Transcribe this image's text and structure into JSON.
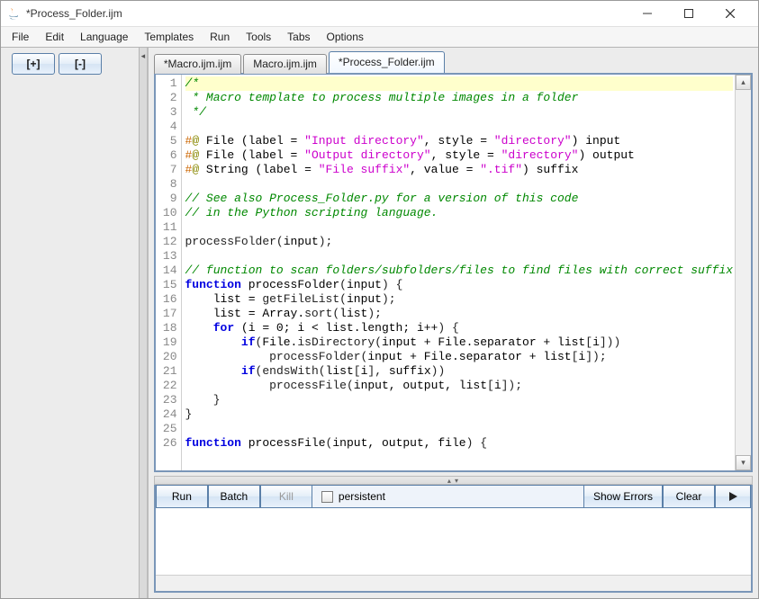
{
  "title": "*Process_Folder.ijm",
  "menu": [
    "File",
    "Edit",
    "Language",
    "Templates",
    "Run",
    "Tools",
    "Tabs",
    "Options"
  ],
  "pm": {
    "plus": "[+]",
    "minus": "[-]"
  },
  "collapse_marker": "◂",
  "tabs": [
    {
      "label": "*Macro.ijm.ijm",
      "active": false
    },
    {
      "label": "Macro.ijm.ijm",
      "active": false
    },
    {
      "label": "*Process_Folder.ijm",
      "active": true
    }
  ],
  "runbar": {
    "run": "Run",
    "batch": "Batch",
    "kill": "Kill",
    "persistent": "persistent",
    "show_errors": "Show Errors",
    "clear": "Clear"
  },
  "scroll": {
    "up": "▴",
    "down": "▾"
  },
  "code": {
    "lines": [
      {
        "n": 1,
        "hl": true,
        "tokens": [
          [
            "comment",
            "/*"
          ]
        ]
      },
      {
        "n": 2,
        "hl": false,
        "tokens": [
          [
            "comment",
            " * Macro template to process multiple images in a folder"
          ]
        ]
      },
      {
        "n": 3,
        "hl": false,
        "tokens": [
          [
            "comment",
            " */"
          ]
        ]
      },
      {
        "n": 4,
        "hl": false,
        "tokens": []
      },
      {
        "n": 5,
        "hl": false,
        "tokens": [
          [
            "hash",
            "#"
          ],
          [
            "at",
            "@"
          ],
          [
            "id",
            " File (label = "
          ],
          [
            "str",
            "\"Input directory\""
          ],
          [
            "id",
            ", style = "
          ],
          [
            "str",
            "\"directory\""
          ],
          [
            "id",
            ") input"
          ]
        ]
      },
      {
        "n": 6,
        "hl": false,
        "tokens": [
          [
            "hash",
            "#"
          ],
          [
            "at",
            "@"
          ],
          [
            "id",
            " File (label = "
          ],
          [
            "str",
            "\"Output directory\""
          ],
          [
            "id",
            ", style = "
          ],
          [
            "str",
            "\"directory\""
          ],
          [
            "id",
            ") output"
          ]
        ]
      },
      {
        "n": 7,
        "hl": false,
        "tokens": [
          [
            "hash",
            "#"
          ],
          [
            "at",
            "@"
          ],
          [
            "id",
            " String (label = "
          ],
          [
            "str",
            "\"File suffix\""
          ],
          [
            "id",
            ", value = "
          ],
          [
            "str",
            "\".tif\""
          ],
          [
            "id",
            ") suffix"
          ]
        ]
      },
      {
        "n": 8,
        "hl": false,
        "tokens": []
      },
      {
        "n": 9,
        "hl": false,
        "tokens": [
          [
            "comment",
            "// See also Process_Folder.py for a version of this code"
          ]
        ]
      },
      {
        "n": 10,
        "hl": false,
        "tokens": [
          [
            "comment",
            "// in the Python scripting language."
          ]
        ]
      },
      {
        "n": 11,
        "hl": false,
        "tokens": []
      },
      {
        "n": 12,
        "hl": false,
        "tokens": [
          [
            "call",
            "processFolder"
          ],
          [
            "pu",
            "("
          ],
          [
            "id",
            "input"
          ],
          [
            "pu",
            ");"
          ]
        ]
      },
      {
        "n": 13,
        "hl": false,
        "tokens": []
      },
      {
        "n": 14,
        "hl": false,
        "tokens": [
          [
            "comment",
            "// function to scan folders/subfolders/files to find files with correct suffix"
          ]
        ]
      },
      {
        "n": 15,
        "hl": false,
        "tokens": [
          [
            "kw",
            "function"
          ],
          [
            "id",
            " processFolder"
          ],
          [
            "pu",
            "("
          ],
          [
            "id",
            "input"
          ],
          [
            "pu",
            ") {"
          ]
        ]
      },
      {
        "n": 16,
        "hl": false,
        "tokens": [
          [
            "id",
            "    list = "
          ],
          [
            "call",
            "getFileList"
          ],
          [
            "pu",
            "("
          ],
          [
            "id",
            "input"
          ],
          [
            "pu",
            ");"
          ]
        ]
      },
      {
        "n": 17,
        "hl": false,
        "tokens": [
          [
            "id",
            "    list = Array."
          ],
          [
            "call",
            "sort"
          ],
          [
            "pu",
            "("
          ],
          [
            "id",
            "list"
          ],
          [
            "pu",
            ");"
          ]
        ]
      },
      {
        "n": 18,
        "hl": false,
        "tokens": [
          [
            "id",
            "    "
          ],
          [
            "kw",
            "for"
          ],
          [
            "id",
            " (i = 0; i < list.length; i++"
          ],
          [
            "pu",
            ") {"
          ]
        ]
      },
      {
        "n": 19,
        "hl": false,
        "tokens": [
          [
            "id",
            "        "
          ],
          [
            "kw",
            "if"
          ],
          [
            "pu",
            "("
          ],
          [
            "id",
            "File."
          ],
          [
            "call",
            "isDirectory"
          ],
          [
            "pu",
            "("
          ],
          [
            "id",
            "input + File.separator + list"
          ],
          [
            "pu",
            "["
          ],
          [
            "id",
            "i"
          ],
          [
            "pu",
            "]))"
          ]
        ]
      },
      {
        "n": 20,
        "hl": false,
        "tokens": [
          [
            "id",
            "            "
          ],
          [
            "call",
            "processFolder"
          ],
          [
            "pu",
            "("
          ],
          [
            "id",
            "input + File.separator + list"
          ],
          [
            "pu",
            "["
          ],
          [
            "id",
            "i"
          ],
          [
            "pu",
            "]);"
          ]
        ]
      },
      {
        "n": 21,
        "hl": false,
        "tokens": [
          [
            "id",
            "        "
          ],
          [
            "kw",
            "if"
          ],
          [
            "pu",
            "("
          ],
          [
            "call",
            "endsWith"
          ],
          [
            "pu",
            "("
          ],
          [
            "id",
            "list"
          ],
          [
            "pu",
            "["
          ],
          [
            "id",
            "i"
          ],
          [
            "pu",
            "], "
          ],
          [
            "id",
            "suffix"
          ],
          [
            "pu",
            "))"
          ]
        ]
      },
      {
        "n": 22,
        "hl": false,
        "tokens": [
          [
            "id",
            "            "
          ],
          [
            "call",
            "processFile"
          ],
          [
            "pu",
            "("
          ],
          [
            "id",
            "input, output, list"
          ],
          [
            "pu",
            "["
          ],
          [
            "id",
            "i"
          ],
          [
            "pu",
            "]);"
          ]
        ]
      },
      {
        "n": 23,
        "hl": false,
        "tokens": [
          [
            "id",
            "    "
          ],
          [
            "pu",
            "}"
          ]
        ]
      },
      {
        "n": 24,
        "hl": false,
        "tokens": [
          [
            "pu",
            "}"
          ]
        ]
      },
      {
        "n": 25,
        "hl": false,
        "tokens": []
      },
      {
        "n": 26,
        "hl": false,
        "tokens": [
          [
            "kw",
            "function"
          ],
          [
            "id",
            " processFile"
          ],
          [
            "pu",
            "("
          ],
          [
            "id",
            "input, output, file"
          ],
          [
            "pu",
            ") {"
          ]
        ]
      }
    ]
  }
}
